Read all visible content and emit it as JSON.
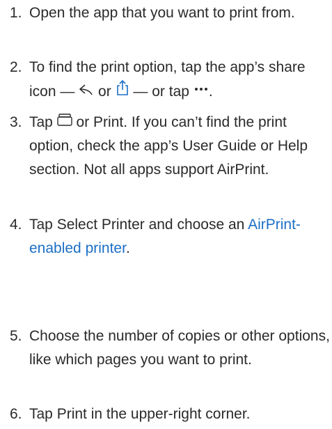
{
  "steps": [
    {
      "num": "1.",
      "text": "Open the app that you want to print from."
    },
    {
      "num": "2.",
      "text_before": "To find the print option, tap the app’s share icon —",
      "or1": "or",
      "dash2": "— or tap",
      "end": "."
    },
    {
      "num": "3.",
      "tap": "Tap",
      "rest": "or Print. If you can’t find the print option, check the app’s User Guide or Help section. Not all apps support AirPrint."
    },
    {
      "num": "4.",
      "before": "Tap Select Printer and choose an",
      "link": "AirPrint-enabled printer",
      "after": "."
    },
    {
      "num": "5.",
      "text": "Choose the number of copies or other options, like which pages you want to print."
    },
    {
      "num": "6.",
      "text": "Tap Print in the upper-right corner."
    }
  ],
  "icons": [
    "share-reply-icon",
    "share-upload-icon",
    "more-ellipsis-icon",
    "print-tray-icon"
  ],
  "colors": {
    "text": "#2a2a2c",
    "link": "#1c6fc6"
  }
}
